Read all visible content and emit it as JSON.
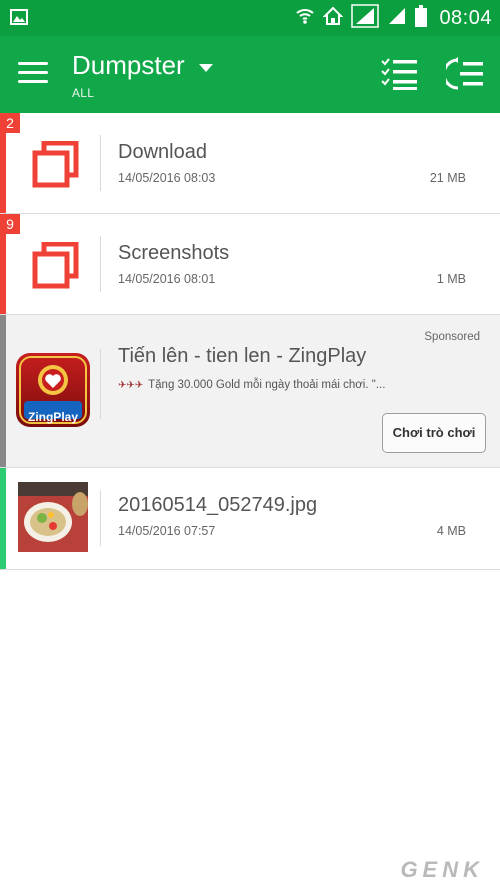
{
  "status_bar": {
    "time": "08:04"
  },
  "app_bar": {
    "title": "Dumpster",
    "subtitle": "ALL"
  },
  "colors": {
    "brand_green": "#11a84a",
    "folder_accent": "#ef4136",
    "ad_accent": "#888888",
    "image_accent": "#2ecc71"
  },
  "items": [
    {
      "type": "folder",
      "badge": "2",
      "name": "Download",
      "date": "14/05/2016 08:03",
      "size": "21 MB",
      "icon": "folder-stack-icon"
    },
    {
      "type": "folder",
      "badge": "9",
      "name": "Screenshots",
      "date": "14/05/2016 08:01",
      "size": "1 MB",
      "icon": "folder-stack-icon"
    }
  ],
  "ad": {
    "sponsored_label": "Sponsored",
    "title": "Tiến lên - tien len - ZingPlay",
    "description": "Tặng 30.000 Gold mỗi ngày thoải mái chơi. \"...",
    "cta": "Chơi trò chơi",
    "app_icon_text": "ZingPlay"
  },
  "file": {
    "name": "20160514_052749.jpg",
    "date": "14/05/2016 07:57",
    "size": "4 MB",
    "icon": "image-thumbnail"
  },
  "watermark": "GENK"
}
